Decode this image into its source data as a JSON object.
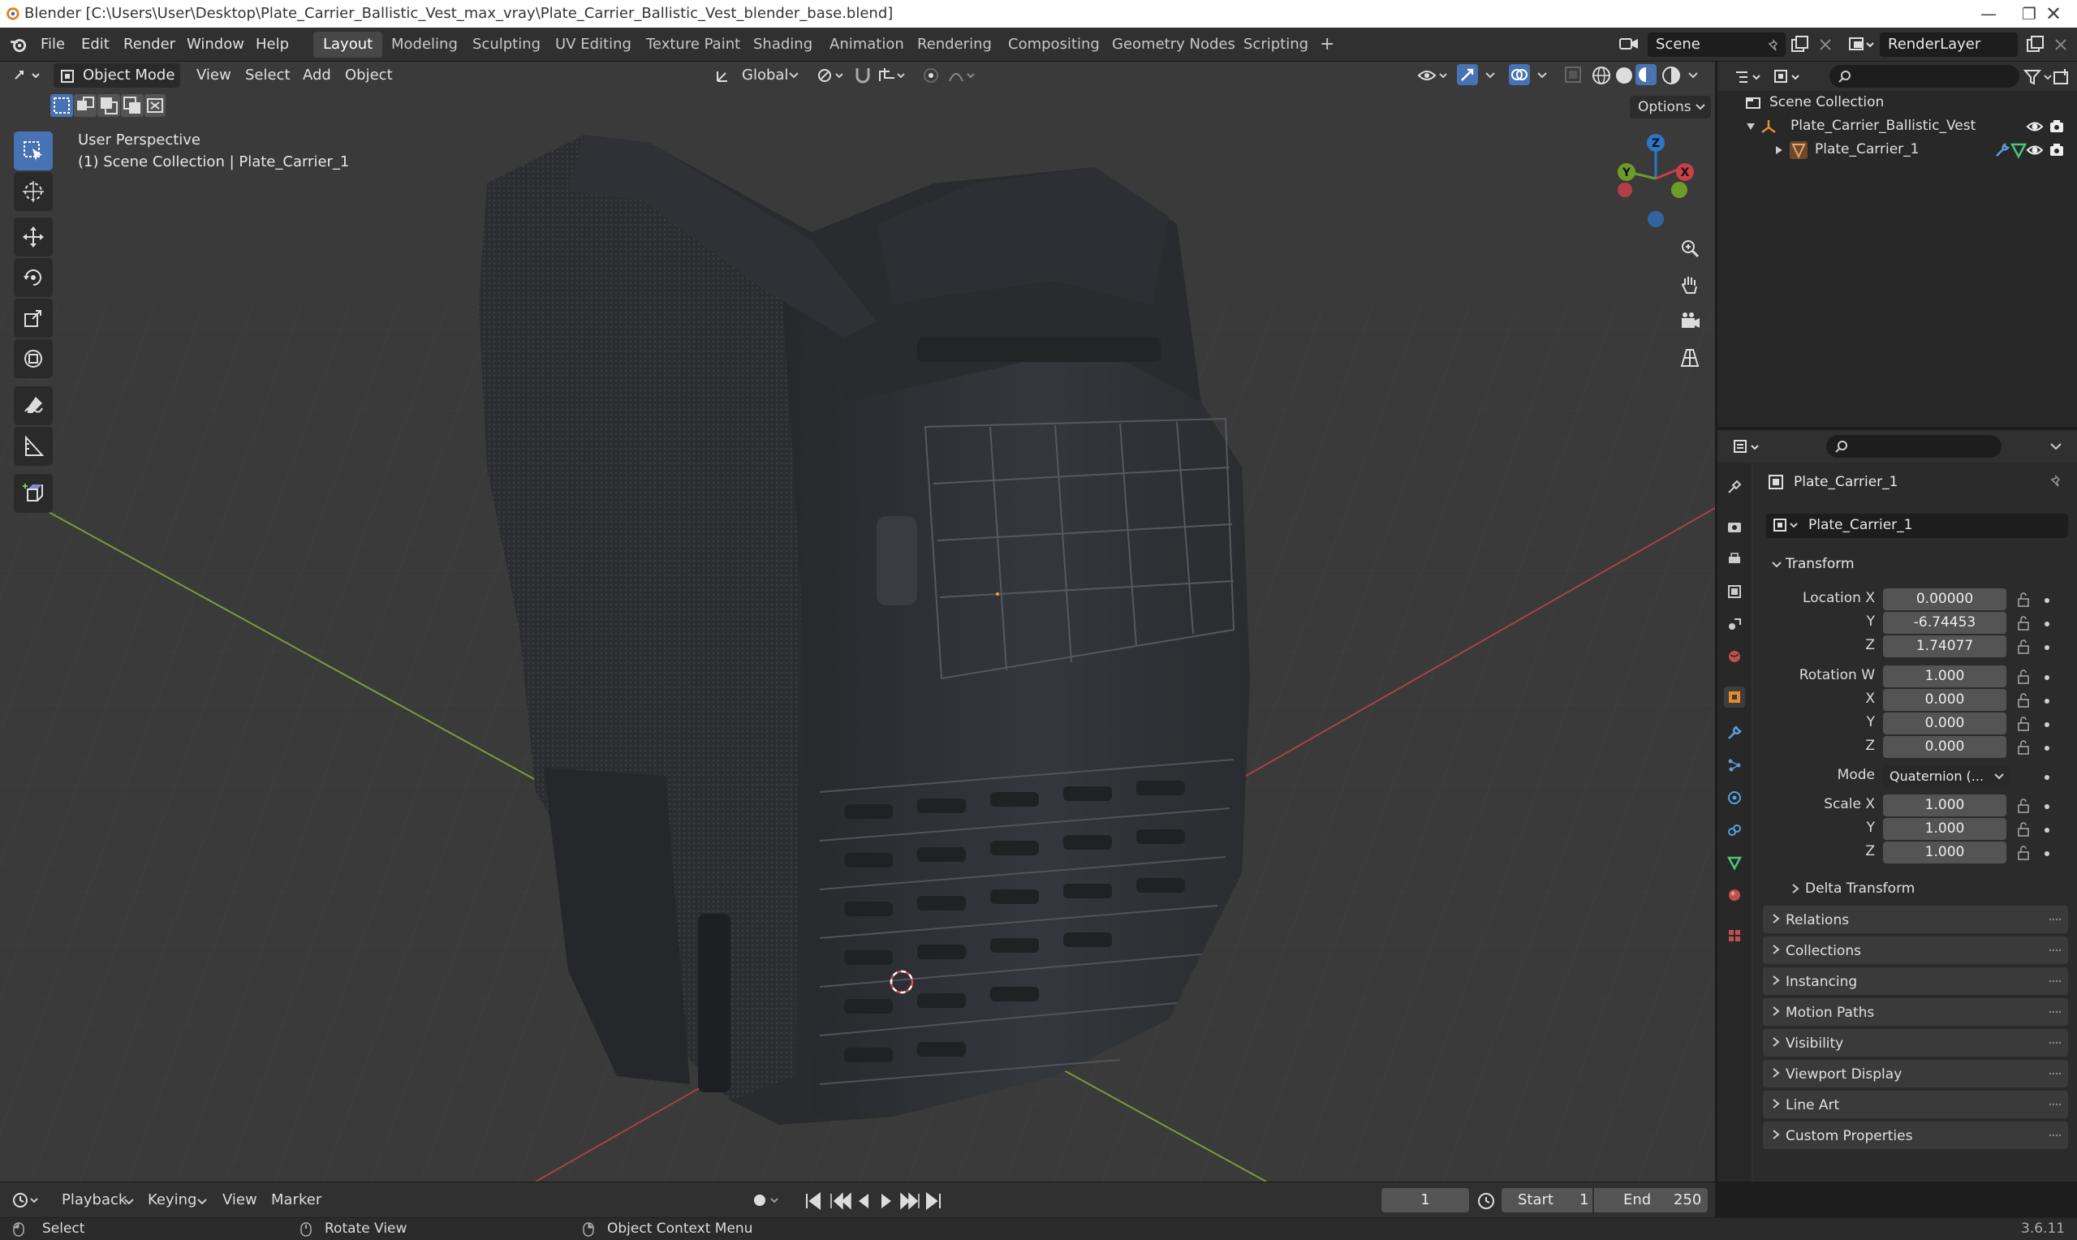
{
  "window": {
    "title": "Blender [C:\\Users\\User\\Desktop\\Plate_Carrier_Ballistic_Vest_max_vray\\Plate_Carrier_Ballistic_Vest_blender_base.blend]",
    "minimize_icon": "minimize-icon",
    "maximize_icon": "restore-icon",
    "close_icon": "close-icon"
  },
  "menu": {
    "items": [
      "File",
      "Edit",
      "Render",
      "Window",
      "Help"
    ]
  },
  "workspaces": {
    "tabs": [
      "Layout",
      "Modeling",
      "Sculpting",
      "UV Editing",
      "Texture Paint",
      "Shading",
      "Animation",
      "Rendering",
      "Compositing",
      "Geometry Nodes",
      "Scripting"
    ],
    "active": "Layout",
    "add_label": "+"
  },
  "scene": {
    "name": "Scene",
    "view_layer": "RenderLayer"
  },
  "viewport": {
    "mode": "Object Mode",
    "menus": [
      "View",
      "Select",
      "Add",
      "Object"
    ],
    "orientation": "Global",
    "options_label": "Options",
    "overlay_title": "User Perspective",
    "overlay_subtitle": "(1) Scene Collection | Plate_Carrier_1",
    "gizmo_axes": {
      "x": "X",
      "y": "Y",
      "z": "Z"
    },
    "colors": {
      "x_axis": "#c8404b",
      "y_axis": "#6e9c28",
      "z_axis": "#2f76c8",
      "bg": "#393939",
      "accent": "#4772b3"
    }
  },
  "outliner": {
    "root": "Scene Collection",
    "items": [
      {
        "label": "Plate_Carrier_Ballistic_Vest",
        "icon": "empty-axes-icon"
      },
      {
        "label": "Plate_Carrier_1",
        "icon": "mesh-object-icon"
      }
    ]
  },
  "properties": {
    "object_name": "Plate_Carrier_1",
    "data_name": "Plate_Carrier_1",
    "transform": {
      "header": "Transform",
      "location_label": "Location X",
      "y_label": "Y",
      "z_label": "Z",
      "x_label": "X",
      "location": {
        "x": "0.00000",
        "y": "-6.74453",
        "z": "1.74077"
      },
      "rotation_label": "Rotation W",
      "rotation": {
        "w": "1.000",
        "x": "0.000",
        "y": "0.000",
        "z": "0.000"
      },
      "mode_label": "Mode",
      "mode_value": "Quaternion (...",
      "scale_label": "Scale X",
      "scale": {
        "x": "1.000",
        "y": "1.000",
        "z": "1.000"
      },
      "delta": "Delta Transform"
    },
    "panels": [
      "Relations",
      "Collections",
      "Instancing",
      "Motion Paths",
      "Visibility",
      "Viewport Display",
      "Line Art",
      "Custom Properties"
    ]
  },
  "timeline": {
    "menus": [
      "Playback",
      "Keying",
      "View",
      "Marker"
    ],
    "current_frame": "1",
    "start_label": "Start",
    "start": "1",
    "end_label": "End",
    "end": "250"
  },
  "status": {
    "select": "Select",
    "rotate": "Rotate View",
    "context": "Object Context Menu",
    "version": "3.6.11"
  }
}
